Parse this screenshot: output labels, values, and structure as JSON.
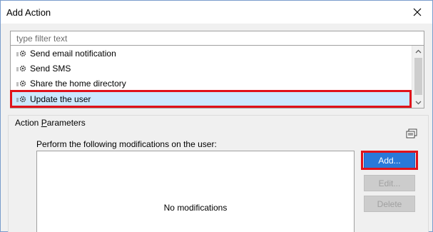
{
  "window": {
    "title": "Add Action"
  },
  "filter": {
    "placeholder": "type filter text"
  },
  "actions": [
    {
      "label": "Send email notification"
    },
    {
      "label": "Send SMS"
    },
    {
      "label": "Share the home directory"
    },
    {
      "label": "Update the user",
      "selected": true
    }
  ],
  "parameters": {
    "group_label_prefix": "Action ",
    "group_label_mnemonic": "P",
    "group_label_rest": "arameters",
    "modifications_label": "Perform the following modifications on the user:",
    "empty_text": "No modifications"
  },
  "buttons": {
    "add": "Add...",
    "edit": "Edit...",
    "delete": "Delete"
  },
  "colors": {
    "highlight": "#e0121b",
    "selection": "#cce8ff",
    "primary": "#2979d9"
  }
}
